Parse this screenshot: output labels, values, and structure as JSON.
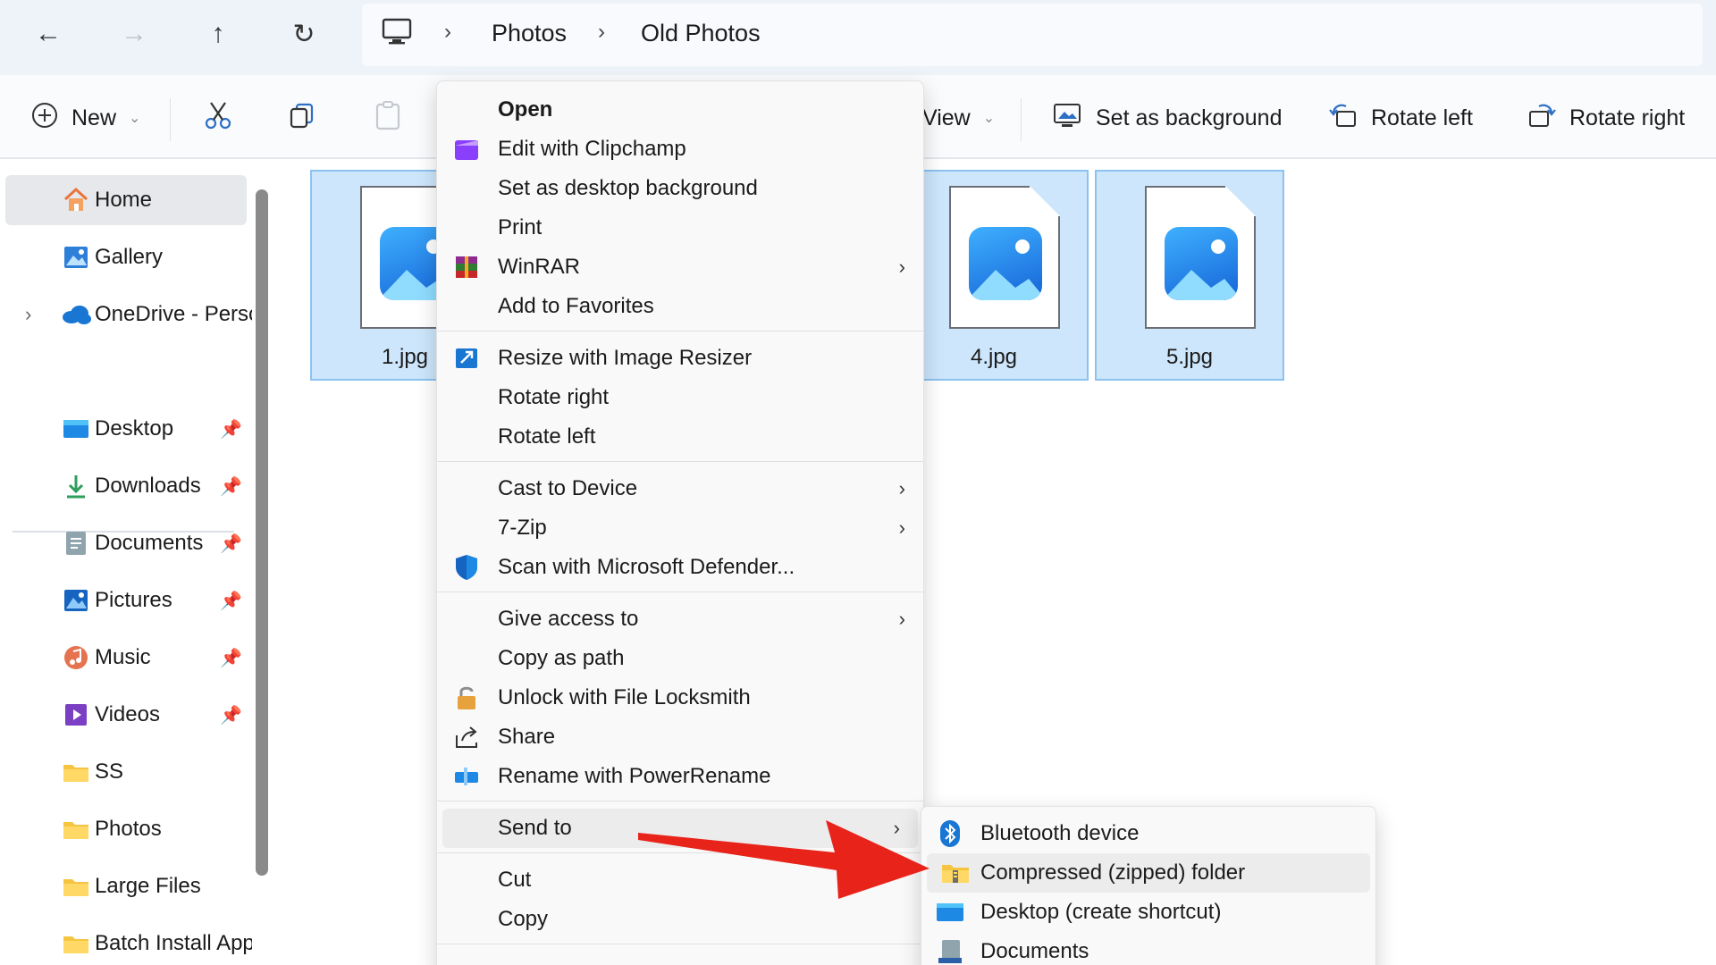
{
  "breadcrumb": {
    "items": [
      "Photos",
      "Old Photos"
    ],
    "separator": "›"
  },
  "toolbar": {
    "new_label": "New",
    "view_label": "View",
    "set_background_label": "Set as background",
    "rotate_left_label": "Rotate left",
    "rotate_right_label": "Rotate right"
  },
  "sidebar": {
    "items": [
      {
        "label": "Home",
        "icon": "home-icon"
      },
      {
        "label": "Gallery",
        "icon": "gallery-icon"
      },
      {
        "label": "OneDrive - Perso",
        "icon": "cloud-icon"
      },
      {
        "label": "Desktop",
        "icon": "desktop-folder-icon"
      },
      {
        "label": "Downloads",
        "icon": "download-icon"
      },
      {
        "label": "Documents",
        "icon": "documents-icon"
      },
      {
        "label": "Pictures",
        "icon": "pictures-icon"
      },
      {
        "label": "Music",
        "icon": "music-icon"
      },
      {
        "label": "Videos",
        "icon": "videos-icon"
      },
      {
        "label": "SS",
        "icon": "folder-icon"
      },
      {
        "label": "Photos",
        "icon": "folder-icon"
      },
      {
        "label": "Large Files",
        "icon": "folder-icon"
      },
      {
        "label": "Batch Install Apps",
        "icon": "folder-icon"
      }
    ]
  },
  "files": [
    {
      "name": "1.jpg"
    },
    {
      "name": "4.jpg"
    },
    {
      "name": "5.jpg"
    }
  ],
  "context_menu": {
    "items": [
      {
        "label": "Open"
      },
      {
        "label": "Edit with Clipchamp"
      },
      {
        "label": "Set as desktop background"
      },
      {
        "label": "Print"
      },
      {
        "label": "WinRAR"
      },
      {
        "label": "Add to Favorites"
      },
      {
        "label": "Resize with Image Resizer"
      },
      {
        "label": "Rotate right"
      },
      {
        "label": "Rotate left"
      },
      {
        "label": "Cast to Device"
      },
      {
        "label": "7-Zip"
      },
      {
        "label": "Scan with Microsoft Defender..."
      },
      {
        "label": "Give access to"
      },
      {
        "label": "Copy as path"
      },
      {
        "label": "Unlock with File Locksmith"
      },
      {
        "label": "Share"
      },
      {
        "label": "Rename with PowerRename"
      },
      {
        "label": "Send to"
      },
      {
        "label": "Cut"
      },
      {
        "label": "Copy"
      }
    ]
  },
  "send_to_menu": {
    "items": [
      {
        "label": "Bluetooth device"
      },
      {
        "label": "Compressed (zipped) folder"
      },
      {
        "label": "Desktop (create shortcut)"
      },
      {
        "label": "Documents"
      }
    ]
  },
  "colors": {
    "accent": "#2d5fa8",
    "selection_fill": "#cde6fb",
    "selection_border": "#8bc2f0",
    "annotation_arrow": "#e8231a"
  }
}
